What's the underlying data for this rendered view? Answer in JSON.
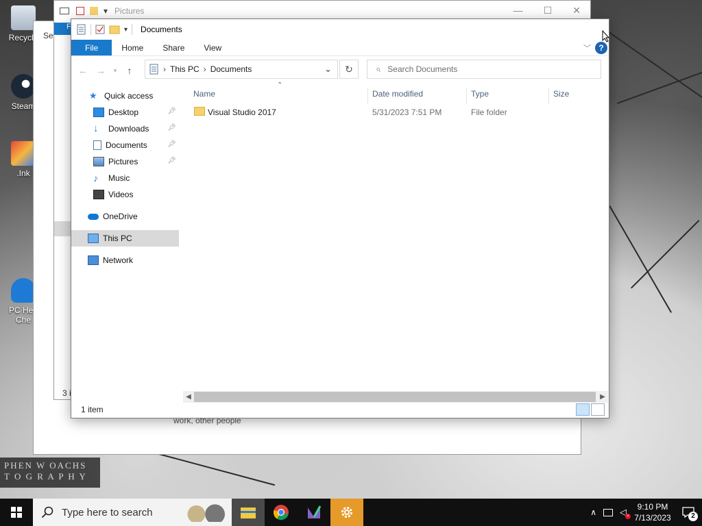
{
  "desktop": {
    "icons": [
      {
        "label": "Recycle"
      },
      {
        "label": "Steam"
      },
      {
        "label": ".Ink"
      },
      {
        "label": "PC Hea Che"
      }
    ],
    "watermark": {
      "line1": "PHEN W OACHS",
      "line2": "T O G R A P H Y"
    }
  },
  "bg_windows": {
    "pictures": {
      "title": "Pictures",
      "status": "3 i"
    },
    "settings": {
      "title": "Set",
      "text": "work, other people"
    }
  },
  "window": {
    "title": "Documents",
    "ribbon": {
      "tabs": [
        "File",
        "Home",
        "Share",
        "View"
      ]
    },
    "address": {
      "segments": [
        "This PC",
        "Documents"
      ]
    },
    "search": {
      "placeholder": "Search Documents"
    },
    "nav": {
      "quick_access": "Quick access",
      "items": [
        {
          "label": "Desktop"
        },
        {
          "label": "Downloads"
        },
        {
          "label": "Documents"
        },
        {
          "label": "Pictures"
        },
        {
          "label": "Music"
        },
        {
          "label": "Videos"
        }
      ],
      "onedrive": "OneDrive",
      "this_pc": "This PC",
      "network": "Network"
    },
    "columns": [
      "Name",
      "Date modified",
      "Type",
      "Size"
    ],
    "rows": [
      {
        "name": "Visual Studio 2017",
        "date": "5/31/2023 7:51 PM",
        "type": "File folder",
        "size": ""
      }
    ],
    "status": "1 item"
  },
  "taskbar": {
    "search_placeholder": "Type here to search",
    "time": "9:10 PM",
    "date": "7/13/2023",
    "notifications": "2"
  },
  "colors": {
    "accent": "#1979ca",
    "folder": "#f7d26b",
    "selected": "#d9d9d9"
  }
}
